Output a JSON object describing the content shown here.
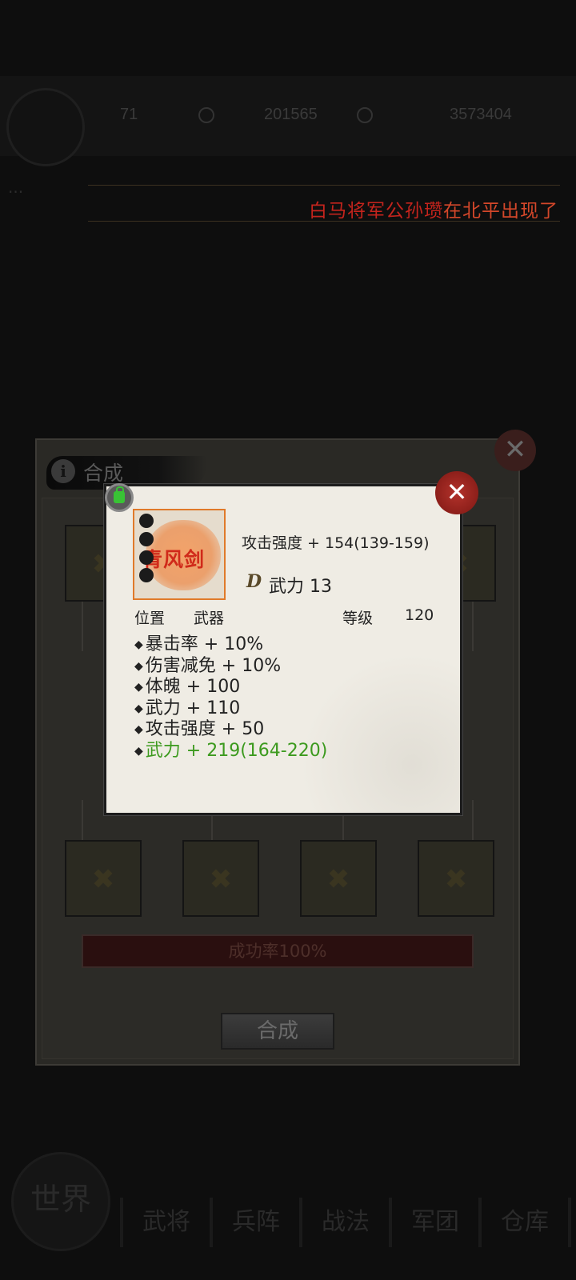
{
  "hud": {
    "resources": [
      {
        "value": "71",
        "icon": "coin-icon"
      },
      {
        "value": "201565",
        "icon": "gem-icon"
      },
      {
        "value": "3573404",
        "icon": "gold-icon"
      }
    ],
    "side_label": "...",
    "ticker": {
      "highlight": "白马将军公孙瓒",
      "rest": "在北平出现了"
    }
  },
  "bottom_nav": {
    "world": "世界",
    "tabs": [
      "武将",
      "兵阵",
      "战法",
      "军团",
      "仓库"
    ]
  },
  "panel": {
    "title": "合成",
    "close_glyph": "✕",
    "success_rate": "成功率100%",
    "synth_button": "合成"
  },
  "item": {
    "name": "青风剑",
    "close_glyph": "✕",
    "attack": "攻击强度 + 154(139-159)",
    "force_badge": "D",
    "force": "武力 13",
    "position_label": "位置",
    "position_value": "武器",
    "level_label": "等级",
    "level_value": "120",
    "bonuses": [
      "暴击率 + 10%",
      "伤害减免 + 10%",
      "体魄 + 100",
      "武力 + 110",
      "攻击强度 + 50",
      "武力 + 219(164-220)"
    ],
    "bonus_diamond": "◆",
    "colors": {
      "normal": "#222222",
      "highlight": "#3c9a1e",
      "ticker": "#c4241d",
      "border": "#e07a2a"
    }
  }
}
